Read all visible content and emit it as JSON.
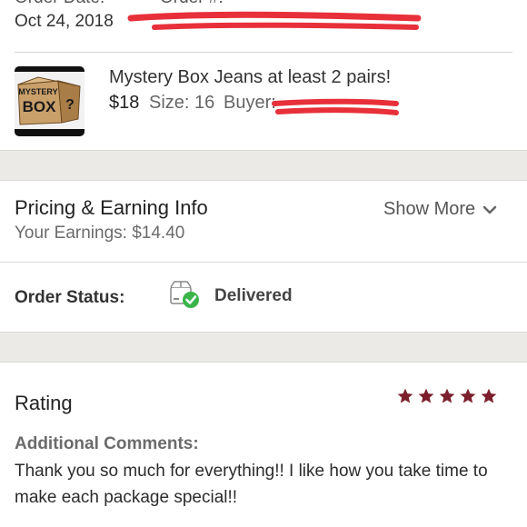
{
  "order": {
    "date_label": "Order Date:",
    "number_label": "Order #:",
    "date": "Oct 24, 2018"
  },
  "item": {
    "thumbnail_text_top": "MYSTERY",
    "thumbnail_text_bottom": "BOX",
    "thumbnail_mark": "?",
    "title": "Mystery Box Jeans at least 2 pairs!",
    "price": "$18",
    "size": "Size: 16",
    "buyer_label": "Buyer:"
  },
  "pricing": {
    "title": "Pricing & Earning Info",
    "earnings": "Your Earnings: $14.40",
    "show_more": "Show More"
  },
  "status": {
    "label": "Order Status:",
    "value": "Delivered",
    "icon": "package-delivered-icon",
    "icon_color": "#3bb54a"
  },
  "rating": {
    "title": "Rating",
    "stars": 5,
    "star_color": "#7a1f2b",
    "comments_label": "Additional Comments:",
    "comments": "Thank you so much for everything!! I like how you take time to make each package special!!"
  },
  "colors": {
    "redaction": "#e8303a",
    "band": "#eceae6"
  }
}
